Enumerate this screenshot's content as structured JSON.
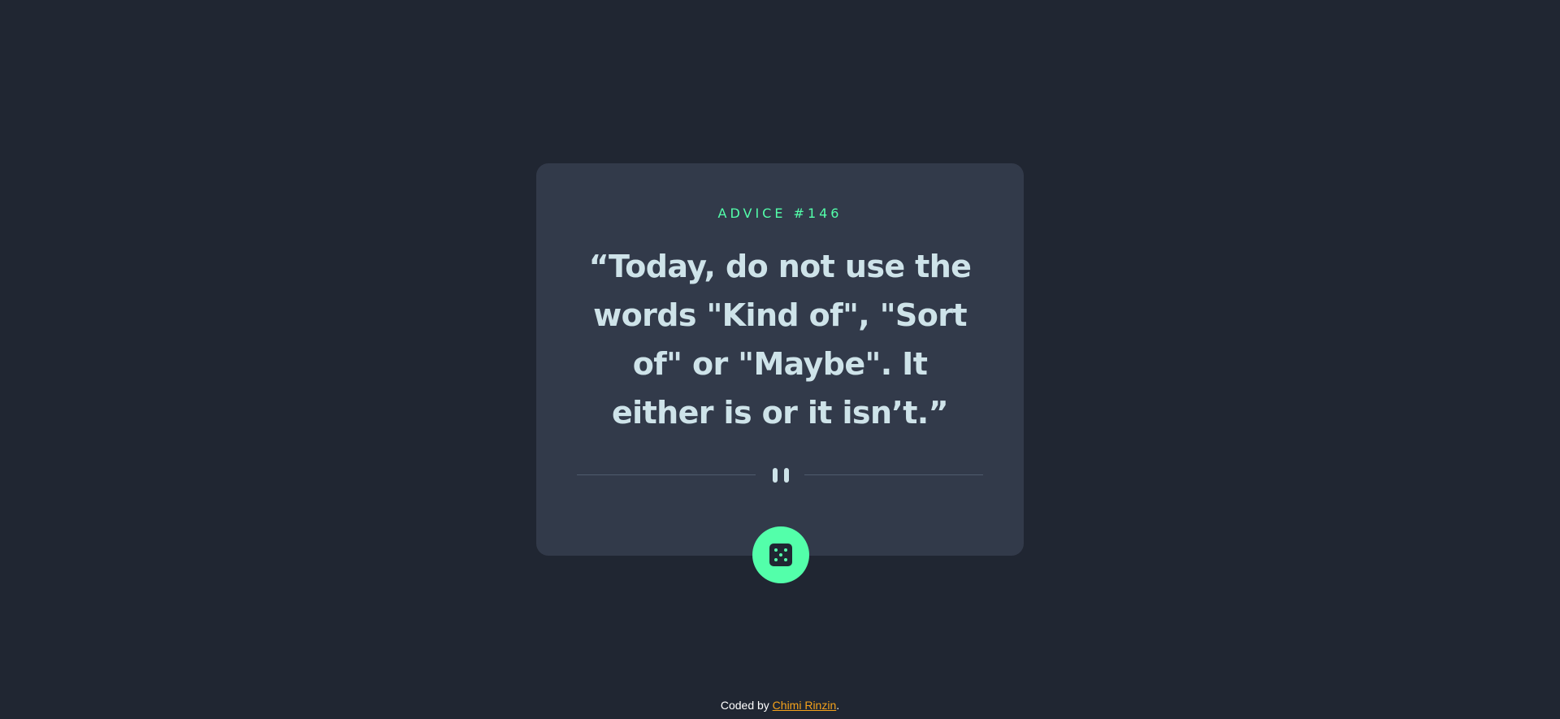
{
  "card": {
    "advice_id": "ADVICE #146",
    "quote": "“Today, do not use the words \"Kind of\", \"Sort of\" or \"Maybe\". It either is or it isn’t.”",
    "divider_icon": "pause-icon"
  },
  "dice_button": {
    "icon": "dice-icon"
  },
  "footer": {
    "prefix": "Coded by ",
    "author": "Chimi Rinzin",
    "suffix": "."
  },
  "colors": {
    "background": "#202632",
    "card": "#323a4a",
    "accent": "#53ffaa",
    "text": "#cee3e9",
    "link": "#f6a21a"
  }
}
